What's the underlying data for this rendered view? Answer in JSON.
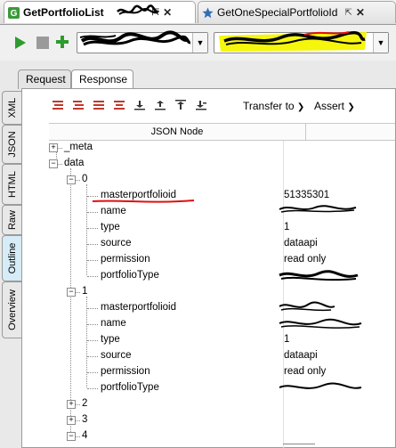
{
  "tabs": [
    {
      "label": "GetPortfolioList",
      "active": true
    },
    {
      "label": "GetOneSpecialPortfolioId",
      "active": false
    }
  ],
  "tab_pin_glyph": "⇱",
  "tab_close_glyph": "✕",
  "subtabs": [
    "Request",
    "Response"
  ],
  "side_tabs": [
    "XML",
    "JSON",
    "HTML",
    "Raw",
    "Outline",
    "Overview"
  ],
  "toolbar_menus": {
    "transfer": "Transfer to",
    "assert": "Assert"
  },
  "column_header": "JSON Node",
  "tree": [
    {
      "label": "_meta",
      "value": "",
      "expander": "+"
    },
    {
      "label": "data",
      "value": "",
      "expander": "-"
    },
    {
      "label": "0",
      "value": "",
      "expander": "-"
    },
    {
      "label": "masterportfolioid",
      "value": "51335301"
    },
    {
      "label": "name",
      "value": ""
    },
    {
      "label": "type",
      "value": "1"
    },
    {
      "label": "source",
      "value": "dataapi"
    },
    {
      "label": "permission",
      "value": "read only"
    },
    {
      "label": "portfolioType",
      "value": ""
    },
    {
      "label": "1",
      "value": "",
      "expander": "-"
    },
    {
      "label": "masterportfolioid",
      "value": ""
    },
    {
      "label": "name",
      "value": ""
    },
    {
      "label": "type",
      "value": "1"
    },
    {
      "label": "source",
      "value": "dataapi"
    },
    {
      "label": "permission",
      "value": "read only"
    },
    {
      "label": "portfolioType",
      "value": ""
    },
    {
      "label": "2",
      "value": "",
      "expander": "+"
    },
    {
      "label": "3",
      "value": "",
      "expander": "+"
    },
    {
      "label": "4",
      "value": "",
      "expander": "-"
    }
  ],
  "colors": {
    "accent_green": "#2e9b2e",
    "highlight_yellow": "#f5f500",
    "redact_red": "#e01010"
  }
}
